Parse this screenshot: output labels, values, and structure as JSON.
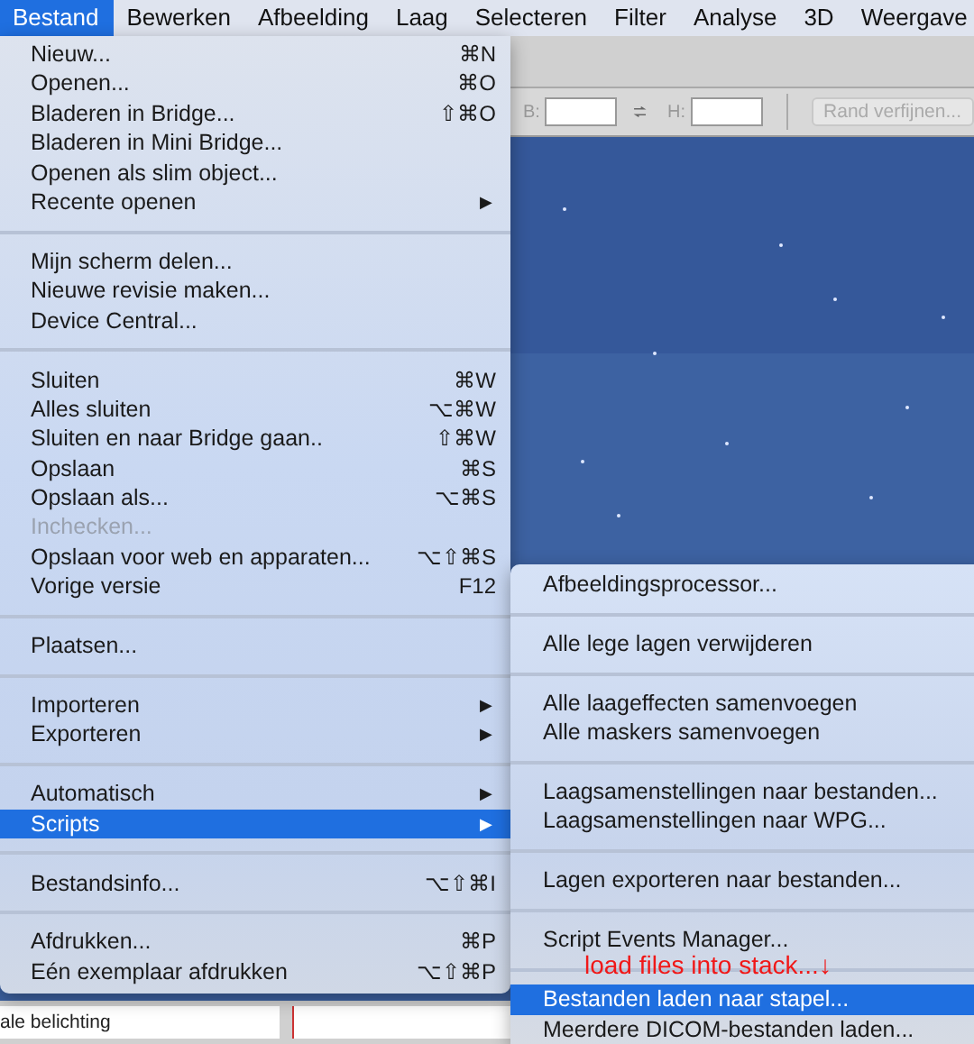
{
  "menu_bar": [
    {
      "label": "Bestand",
      "selected": true
    },
    {
      "label": "Bewerken",
      "selected": false
    },
    {
      "label": "Afbeelding",
      "selected": false
    },
    {
      "label": "Laag",
      "selected": false
    },
    {
      "label": "Selecteren",
      "selected": false
    },
    {
      "label": "Filter",
      "selected": false
    },
    {
      "label": "Analyse",
      "selected": false
    },
    {
      "label": "3D",
      "selected": false
    },
    {
      "label": "Weergave",
      "selected": false
    }
  ],
  "options_bar": {
    "width_label": "B:",
    "height_label": "H:",
    "refine_button": {
      "label": "Rand verfijnen...",
      "disabled": true
    }
  },
  "bottom_strip": {
    "field_text": "ale belichting"
  },
  "file_menu": {
    "groups": [
      {
        "items": [
          {
            "label": "Nieuw...",
            "shortcut": "⌘N",
            "selected": false,
            "disabled": false
          },
          {
            "label": "Openen...",
            "shortcut": "⌘O",
            "selected": false,
            "disabled": false
          },
          {
            "label": "Bladeren in Bridge...",
            "shortcut": "⇧⌘O",
            "selected": false,
            "disabled": false
          },
          {
            "label": "Bladeren in Mini Bridge...",
            "selected": false,
            "disabled": false
          },
          {
            "label": "Openen als slim object...",
            "selected": false,
            "disabled": false
          },
          {
            "label": "Recente openen",
            "arrow": "▶",
            "selected": false,
            "disabled": false
          }
        ]
      },
      {
        "items": [
          {
            "label": "Mijn scherm delen...",
            "selected": false,
            "disabled": false
          },
          {
            "label": "Nieuwe revisie maken...",
            "selected": false,
            "disabled": false
          },
          {
            "label": "Device Central...",
            "selected": false,
            "disabled": false
          }
        ]
      },
      {
        "items": [
          {
            "label": "Sluiten",
            "shortcut": "⌘W",
            "selected": false,
            "disabled": false
          },
          {
            "label": "Alles sluiten",
            "shortcut": "⌥⌘W",
            "selected": false,
            "disabled": false
          },
          {
            "label": "Sluiten en naar Bridge gaan..",
            "shortcut": "⇧⌘W",
            "selected": false,
            "disabled": false
          },
          {
            "label": "Opslaan",
            "shortcut": "⌘S",
            "selected": false,
            "disabled": false
          },
          {
            "label": "Opslaan als...",
            "shortcut": "⌥⌘S",
            "selected": false,
            "disabled": false
          },
          {
            "label": "Inchecken...",
            "selected": false,
            "disabled": true
          },
          {
            "label": "Opslaan voor web en apparaten...",
            "shortcut": "⌥⇧⌘S",
            "selected": false,
            "disabled": false
          },
          {
            "label": "Vorige versie",
            "shortcut": "F12",
            "selected": false,
            "disabled": false
          }
        ]
      },
      {
        "items": [
          {
            "label": "Plaatsen...",
            "selected": false,
            "disabled": false
          }
        ]
      },
      {
        "items": [
          {
            "label": "Importeren",
            "arrow": "▶",
            "selected": false,
            "disabled": false
          },
          {
            "label": "Exporteren",
            "arrow": "▶",
            "selected": false,
            "disabled": false
          }
        ]
      },
      {
        "items": [
          {
            "label": "Automatisch",
            "arrow": "▶",
            "selected": false,
            "disabled": false
          },
          {
            "label": "Scripts",
            "arrow": "▶",
            "selected": true,
            "disabled": false
          }
        ]
      },
      {
        "items": [
          {
            "label": "Bestandsinfo...",
            "shortcut": "⌥⇧⌘I",
            "selected": false,
            "disabled": false
          }
        ]
      },
      {
        "items": [
          {
            "label": "Afdrukken...",
            "shortcut": "⌘P",
            "selected": false,
            "disabled": false
          },
          {
            "label": "Eén exemplaar afdrukken",
            "shortcut": "⌥⇧⌘P",
            "selected": false,
            "disabled": false
          }
        ]
      }
    ]
  },
  "scripts_submenu": {
    "groups": [
      {
        "items": [
          {
            "label": "Afbeeldingsprocessor...",
            "selected": false,
            "disabled": false
          }
        ]
      },
      {
        "items": [
          {
            "label": "Alle lege lagen verwijderen",
            "selected": false,
            "disabled": false
          }
        ]
      },
      {
        "items": [
          {
            "label": "Alle laageffecten samenvoegen",
            "selected": false,
            "disabled": false
          },
          {
            "label": "Alle maskers samenvoegen",
            "selected": false,
            "disabled": false
          }
        ]
      },
      {
        "items": [
          {
            "label": "Laagsamenstellingen naar bestanden...",
            "selected": false,
            "disabled": false
          },
          {
            "label": "Laagsamenstellingen naar WPG...",
            "selected": false,
            "disabled": false
          }
        ]
      },
      {
        "items": [
          {
            "label": "Lagen exporteren naar bestanden...",
            "selected": false,
            "disabled": false
          }
        ]
      },
      {
        "items": [
          {
            "label": "Script Events Manager...",
            "selected": false,
            "disabled": false
          }
        ]
      },
      {
        "items": [
          {
            "label": "Bestanden laden naar stapel...",
            "selected": true,
            "disabled": false
          },
          {
            "label": "Meerdere DICOM-bestanden laden...",
            "selected": false,
            "disabled": false
          }
        ]
      }
    ]
  },
  "annotation": {
    "text": "load files into stack...↓"
  }
}
